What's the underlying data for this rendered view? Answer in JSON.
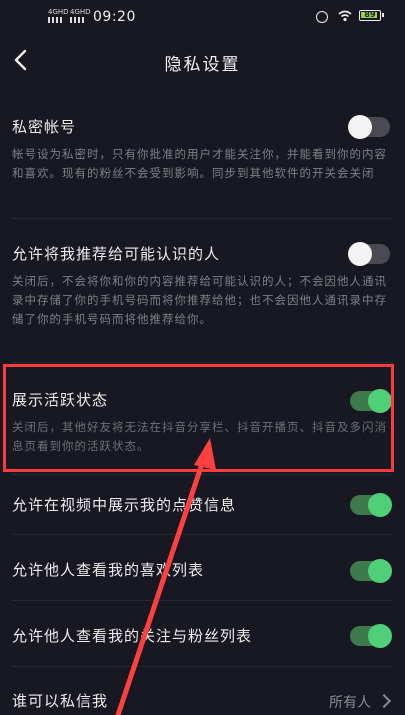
{
  "status_bar": {
    "signal1": "4GHD",
    "signal2": "4GHD",
    "time": "09:20",
    "battery": "89"
  },
  "header": {
    "title": "隐私设置"
  },
  "settings": [
    {
      "label": "私密帐号",
      "desc": "帐号设为私密时，只有你批准的用户才能关注你，并能看到你的内容和喜欢。现有的粉丝不会受到影响。同步到其他软件的开关会关闭",
      "toggle": "off"
    },
    {
      "label": "允许将我推荐给可能认识的人",
      "desc": "关闭后，不会将你和你的内容推荐给可能认识的人；不会因他人通讯录中存储了你的手机号码而将你推荐给他；也不会因他人通讯录中存储了你的手机号码而将他推荐给你。",
      "toggle": "off"
    },
    {
      "label": "展示活跃状态",
      "desc": "关闭后，其他好友将无法在抖音分享栏、抖音开播页、抖音及多闪消息页看到你的活跃状态。",
      "toggle": "on"
    },
    {
      "label": "允许在视频中展示我的点赞信息",
      "toggle": "on"
    },
    {
      "label": "允许他人查看我的喜欢列表",
      "toggle": "on"
    },
    {
      "label": "允许他人查看我的关注与粉丝列表",
      "toggle": "on"
    },
    {
      "label": "谁可以私信我",
      "value": "所有人"
    }
  ]
}
